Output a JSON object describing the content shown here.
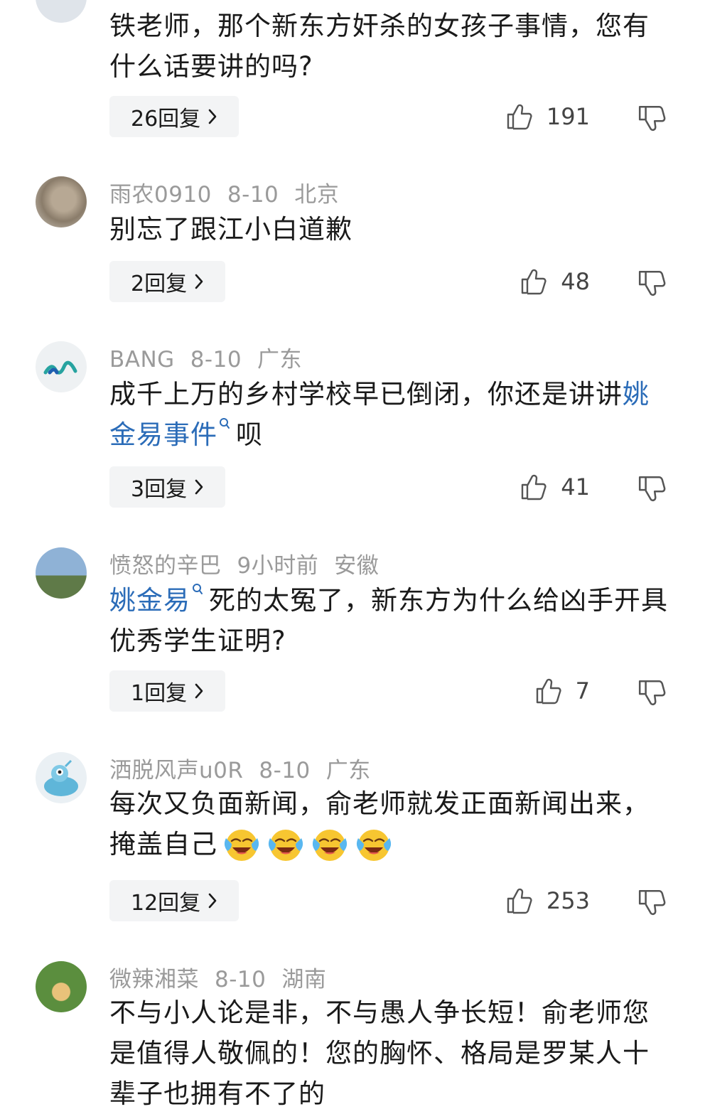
{
  "comments": [
    {
      "user": "",
      "date": "",
      "location": "",
      "text": "铁老师，那个新东方奸杀的女孩子事情，您有什么话要讲的吗?",
      "replies_label": "26回复",
      "likes": "191"
    },
    {
      "user": "雨农0910",
      "date": "8-10",
      "location": "北京",
      "text": "别忘了跟江小白道歉",
      "replies_label": "2回复",
      "likes": "48"
    },
    {
      "user": "BANG",
      "date": "8-10",
      "location": "广东",
      "text_before": "成千上万的乡村学校早已倒闭，你还是讲讲",
      "link": "姚金易事件",
      "text_after": "呗",
      "replies_label": "3回复",
      "likes": "41"
    },
    {
      "user": "愤怒的辛巴",
      "date": "9小时前",
      "location": "安徽",
      "link": "姚金易",
      "text_after": "死的太冤了，新东方为什么给凶手开具优秀学生证明?",
      "replies_label": "1回复",
      "likes": "7"
    },
    {
      "user": "洒脱风声u0R",
      "date": "8-10",
      "location": "广东",
      "text": "每次又负面新闻，俞老师就发正面新闻出来，掩盖自己",
      "emoji": "crying-laughing",
      "replies_label": "12回复",
      "likes": "253"
    },
    {
      "user": "微辣湘菜",
      "date": "8-10",
      "location": "湖南",
      "text": "不与小人论是非，不与愚人争长短！俞老师您是值得人敬佩的！您的胸怀、格局是罗某人十辈子也拥有不了的"
    }
  ],
  "icons": {
    "like": "thumbs-up-icon",
    "dislike": "thumbs-down-icon",
    "chevron": "chevron-right-icon",
    "search": "search-icon"
  },
  "colors": {
    "link": "#2b6cb8",
    "meta": "#9a9a9a",
    "pill_bg": "#f3f4f5"
  }
}
